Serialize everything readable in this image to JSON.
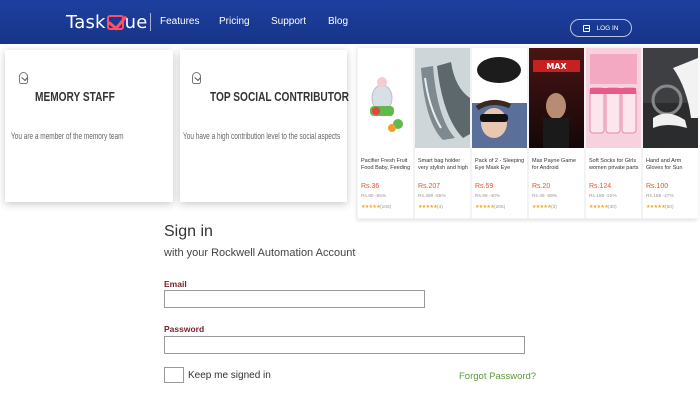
{
  "header": {
    "logo_left": "Task",
    "logo_right": "ue",
    "nav": [
      "Features",
      "Pricing",
      "Support",
      "Blog"
    ],
    "login_label": "LOG IN"
  },
  "badges": [
    {
      "title": "MEMORY STAFF",
      "description": "You are a member of the memory team"
    },
    {
      "title": "TOP SOCIAL CONTRIBUTOR",
      "description": "You have a high contribution level to the social aspects"
    }
  ],
  "products": [
    {
      "title": "Pacifier Fresh Fruit Food Baby, Feeding Safe Fruit",
      "price": "Rs.36",
      "original": "Rs.80 -55%",
      "rating": "(106)"
    },
    {
      "title": "Smart bag holder very stylish and high quality ac...",
      "price": "Rs.207",
      "original": "Rs.459 -55%",
      "rating": "(4)"
    },
    {
      "title": "Pack of 2 - Sleeping Eye Mask Eye Shade Cove...",
      "price": "Rs.59",
      "original": "Rs.99 -40%",
      "rating": "(205)"
    },
    {
      "title": "Max Payne Game for Android Smartphones ...",
      "price": "Rs.20",
      "original": "Rs.49 -59%",
      "rating": "(3)"
    },
    {
      "title": "Soft Socks for Girls women private parts goods...",
      "price": "Rs.124",
      "original": "Rs.159 -22%",
      "rating": "(30)"
    },
    {
      "title": "Hand and Arm Gloves for Sun Women (Multi...",
      "price": "Rs.100",
      "original": "Rs.189 -47%",
      "rating": "(50)"
    }
  ],
  "signin": {
    "title": "Sign in",
    "subtitle": "with your Rockwell Automation Account",
    "email_label": "Email",
    "email_value": "",
    "password_label": "Password",
    "password_value": "",
    "keep_signed_in": "Keep me signed in",
    "forgot_password": "Forgot Password?"
  }
}
